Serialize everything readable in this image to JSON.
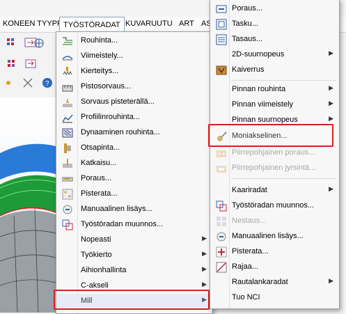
{
  "menubar": {
    "items": [
      "KONEEN TYYPPI",
      "TYÖSTÖRADAT",
      "KUVARUUTU",
      "ART",
      "AS"
    ]
  },
  "toolpath_menu": {
    "items": [
      {
        "label": "Rouhinta...",
        "icon": "pocket-rough-icon"
      },
      {
        "label": "Viimeistely...",
        "icon": "finish-icon"
      },
      {
        "label": "Kierteitys...",
        "icon": "thread-icon"
      },
      {
        "label": "Pistosorvaus...",
        "icon": "groove-icon"
      },
      {
        "label": "Sorvaus pisteterällä...",
        "icon": "point-turn-icon"
      },
      {
        "label": "Profiilinrouhinta...",
        "icon": "profile-rough-icon"
      },
      {
        "label": "Dynaaminen rouhinta...",
        "icon": "dynamic-rough-icon"
      },
      {
        "label": "Otsapinta...",
        "icon": "face-icon"
      },
      {
        "label": "Katkaisu...",
        "icon": "cutoff-icon"
      },
      {
        "label": "Poraus...",
        "icon": "drill-icon"
      },
      {
        "label": "Pisterata...",
        "icon": "point-path-icon"
      },
      {
        "label": "Manuaalinen lisäys...",
        "icon": "manual-entry-icon"
      },
      {
        "label": "Työstöradan muunnos...",
        "icon": "transform-icon"
      },
      {
        "label": "Nopeasti",
        "submenu": true
      },
      {
        "label": "Työkierto",
        "submenu": true
      },
      {
        "label": "Aihionhallinta",
        "submenu": true
      },
      {
        "label": "C-akseli",
        "submenu": true
      },
      {
        "label": "Mill",
        "submenu": true
      }
    ]
  },
  "mill_menu": {
    "items": [
      {
        "label": "Poraus...",
        "icon": "drill-icon"
      },
      {
        "label": "Tasku...",
        "icon": "pocket-icon"
      },
      {
        "label": "Tasaus...",
        "icon": "facing-icon"
      },
      {
        "label": "2D-suurnopeus",
        "submenu": true
      },
      {
        "label": "Kaiverrus",
        "icon": "engrave-icon"
      },
      {
        "label": "Pinnan rouhinta",
        "submenu": true
      },
      {
        "label": "Pinnan viimeistely",
        "submenu": true
      },
      {
        "label": "Pinnan suurnopeus",
        "submenu": true
      },
      {
        "label": "Moniakselinen...",
        "icon": "multiaxis-icon"
      },
      {
        "label": "Piirrepohjainen poraus...",
        "icon": "fbm-drill-icon",
        "disabled": true
      },
      {
        "label": "Piirrepohjainen jyrsintä...",
        "icon": "fbm-mill-icon",
        "disabled": true
      },
      {
        "label": "Kaariradat",
        "submenu": true
      },
      {
        "label": "Työstöradan muunnos...",
        "icon": "transform-icon"
      },
      {
        "label": "Nestaus...",
        "icon": "nesting-icon",
        "disabled": true
      },
      {
        "label": "Manuaalinen lisäys...",
        "icon": "manual-entry-icon"
      },
      {
        "label": "Pisterata...",
        "icon": "point-path-icon"
      },
      {
        "label": "Rajaa...",
        "icon": "trim-icon"
      },
      {
        "label": "Rautalankaradat",
        "submenu": true
      },
      {
        "label": "Tuo NCI"
      }
    ]
  }
}
